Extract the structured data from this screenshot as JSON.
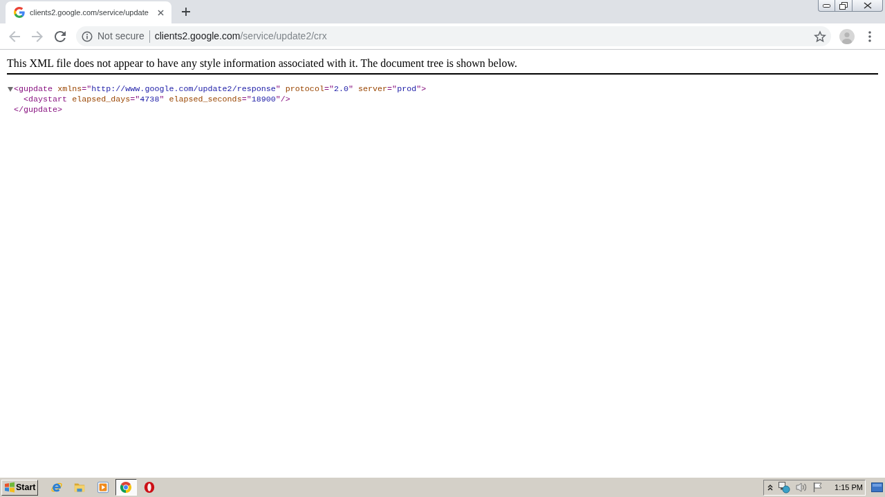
{
  "tabs": [
    {
      "title": "clients2.google.com/service/update",
      "selected": true
    }
  ],
  "nav_buttons": [
    {
      "kind": "back",
      "disabled": true
    },
    {
      "kind": "forward",
      "disabled": true
    },
    {
      "kind": "reload",
      "disabled": false
    }
  ],
  "address_bar": {
    "security_label": "Not secure",
    "host": "clients2.google.com",
    "path": "/service/update2/crx"
  },
  "page": {
    "notice": "This XML file does not appear to have any style information associated with it. The document tree is shown below.",
    "xml_tree": [
      {
        "expanded": true,
        "open_tag": [
          {
            "kind": "tag",
            "text": "<gupdate"
          },
          {
            "kind": "attr_name",
            "text": "xmlns"
          },
          {
            "kind": "tag",
            "text": "=\""
          },
          {
            "kind": "attr_value",
            "text": "http://www.google.com/update2/response"
          },
          {
            "kind": "tag",
            "text": "\""
          },
          {
            "kind": "attr_name",
            "text": "protocol"
          },
          {
            "kind": "tag",
            "text": "=\""
          },
          {
            "kind": "attr_value",
            "text": "2.0"
          },
          {
            "kind": "tag",
            "text": "\""
          },
          {
            "kind": "attr_name",
            "text": "server"
          },
          {
            "kind": "tag",
            "text": "=\""
          },
          {
            "kind": "attr_value",
            "text": "prod"
          },
          {
            "kind": "tag",
            "text": "\">"
          }
        ],
        "children": [
          {
            "open_tag": [
              {
                "kind": "tag",
                "text": "<daystart"
              },
              {
                "kind": "attr_name",
                "text": "elapsed_days"
              },
              {
                "kind": "tag",
                "text": "=\""
              },
              {
                "kind": "attr_value",
                "text": "4738"
              },
              {
                "kind": "tag",
                "text": "\""
              },
              {
                "kind": "attr_name",
                "text": "elapsed_seconds"
              },
              {
                "kind": "tag",
                "text": "=\""
              },
              {
                "kind": "attr_value",
                "text": "18900"
              },
              {
                "kind": "tag",
                "text": "\"/>"
              }
            ]
          }
        ],
        "close_tag": [
          {
            "kind": "tag",
            "text": "</gupdate>"
          }
        ]
      }
    ]
  },
  "taskbar": {
    "start_label": "Start",
    "items": [
      {
        "kind": "e_logo",
        "selected": false
      },
      {
        "kind": "folder",
        "selected": false
      },
      {
        "kind": "play",
        "selected": false
      },
      {
        "kind": "ring_logo",
        "selected": true
      },
      {
        "kind": "o_logo",
        "selected": false
      }
    ],
    "clock": "1:15 PM"
  }
}
